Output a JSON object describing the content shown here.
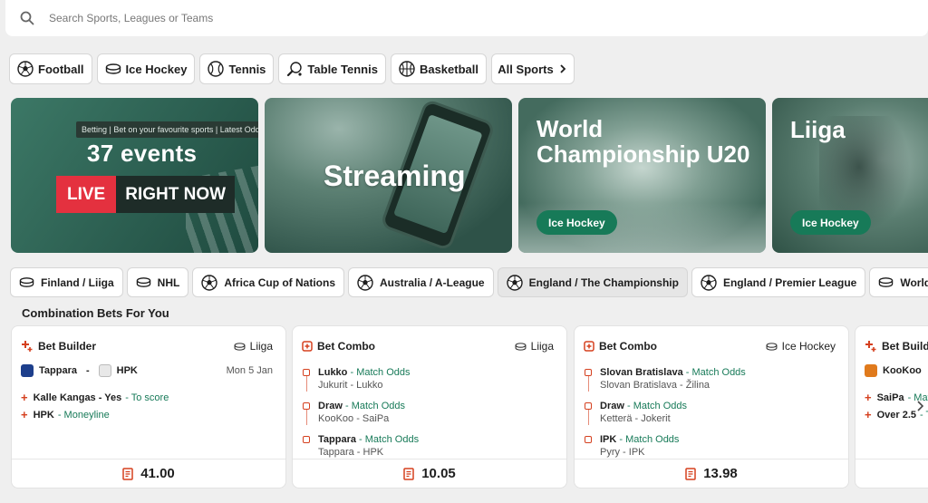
{
  "search": {
    "placeholder": "Search Sports, Leagues or Teams"
  },
  "sports_nav": [
    {
      "label": "Football",
      "icon": "football-icon"
    },
    {
      "label": "Ice Hockey",
      "icon": "ice-hockey-puck-icon"
    },
    {
      "label": "Tennis",
      "icon": "tennis-ball-icon"
    },
    {
      "label": "Table Tennis",
      "icon": "table-tennis-paddle-icon"
    },
    {
      "label": "Basketball",
      "icon": "basketball-icon"
    },
    {
      "label": "All Sports",
      "icon": "chevron-right-icon"
    }
  ],
  "banners": {
    "live": {
      "tagline": "Betting | Bet on your favourite sports | Latest Odds",
      "events": "37 events",
      "live": "LIVE",
      "right_now": "RIGHT NOW"
    },
    "streaming": {
      "title": "Streaming"
    },
    "wc": {
      "title": "World Championship U20",
      "tag": "Ice Hockey"
    },
    "liiga": {
      "title": "Liiga",
      "tag": "Ice Hockey"
    }
  },
  "leagues": [
    {
      "label": "Finland / Liiga",
      "icon": "ice-hockey-puck-icon"
    },
    {
      "label": "NHL",
      "icon": "ice-hockey-puck-icon"
    },
    {
      "label": "Africa Cup of Nations",
      "icon": "football-icon"
    },
    {
      "label": "Australia / A-League",
      "icon": "football-icon"
    },
    {
      "label": "England / The Championship",
      "icon": "football-icon",
      "selected": true
    },
    {
      "label": "England / Premier League",
      "icon": "football-icon"
    },
    {
      "label": "World Cha",
      "icon": "ice-hockey-puck-icon"
    }
  ],
  "section_title": "Combination Bets For You",
  "cards": [
    {
      "type": "Bet Builder",
      "sport": "Liiga",
      "home": "Tappara",
      "away": "HPK",
      "date": "Mon 5 Jan",
      "selections": [
        {
          "name": "Kalle Kangas - Yes",
          "market": "- To score"
        },
        {
          "name": "HPK",
          "market": "- Moneyline"
        }
      ],
      "odds": "41.00"
    },
    {
      "type": "Bet Combo",
      "sport": "Liiga",
      "legs": [
        {
          "pick": "Lukko",
          "market": "- Match Odds",
          "event": "Jukurit - Lukko"
        },
        {
          "pick": "Draw",
          "market": "- Match Odds",
          "event": "KooKoo - SaiPa"
        },
        {
          "pick": "Tappara",
          "market": "- Match Odds",
          "event": "Tappara - HPK"
        }
      ],
      "odds": "10.05"
    },
    {
      "type": "Bet Combo",
      "sport": "Ice Hockey",
      "legs": [
        {
          "pick": "Slovan Bratislava",
          "market": "- Match Odds",
          "event": "Slovan Bratislava - Žilina"
        },
        {
          "pick": "Draw",
          "market": "- Match Odds",
          "event": "Ketterä - Jokerit"
        },
        {
          "pick": "IPK",
          "market": "- Match Odds",
          "event": "Pyry - IPK"
        }
      ],
      "odds": "13.98"
    },
    {
      "type": "Bet Builder",
      "home": "KooKoo",
      "selections": [
        {
          "name": "SaiPa",
          "market": "- Mat"
        },
        {
          "name": "Over 2.5",
          "market": "- T"
        }
      ]
    }
  ],
  "colors": {
    "brand_green": "#177a58",
    "accent_red": "#d5401f",
    "live_red": "#e4313f"
  }
}
